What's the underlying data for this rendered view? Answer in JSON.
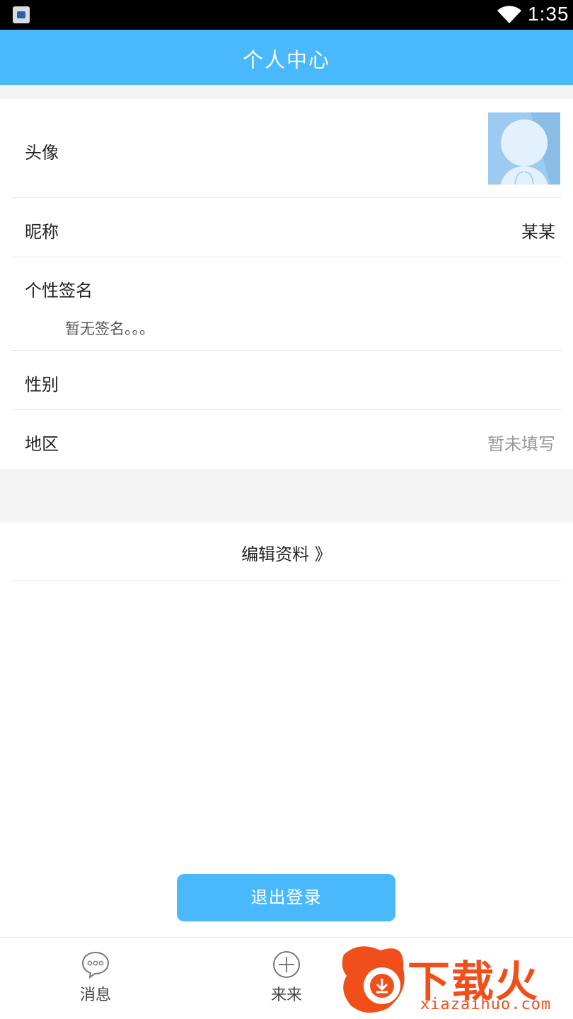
{
  "status_bar": {
    "time": "1:35",
    "wifi_icon": "wifi-icon",
    "app_icon": "app-notification-icon"
  },
  "header": {
    "title": "个人中心"
  },
  "profile": {
    "avatar": {
      "label": "头像",
      "icon": "default-avatar"
    },
    "nickname": {
      "label": "昵称",
      "value": "某某"
    },
    "signature": {
      "label": "个性签名",
      "value": "暂无签名。。。"
    },
    "gender": {
      "label": "性别",
      "value": ""
    },
    "region": {
      "label": "地区",
      "value": "暂未填写"
    }
  },
  "edit": {
    "label": "编辑资料 》",
    "icon": "double-chevron-right-icon"
  },
  "logout": {
    "label": "退出登录"
  },
  "tabs": [
    {
      "label": "消息",
      "icon": "chat-bubble-icon"
    },
    {
      "label": "来来",
      "icon": "plus-circle-icon"
    }
  ],
  "watermark": {
    "brand": "下载火",
    "url": "xiazaihuo.com"
  },
  "colors": {
    "accent": "#4ab9fb",
    "divider": "#e6e6e6",
    "background_gray": "#f3f3f3",
    "watermark": "#f04f1c"
  }
}
